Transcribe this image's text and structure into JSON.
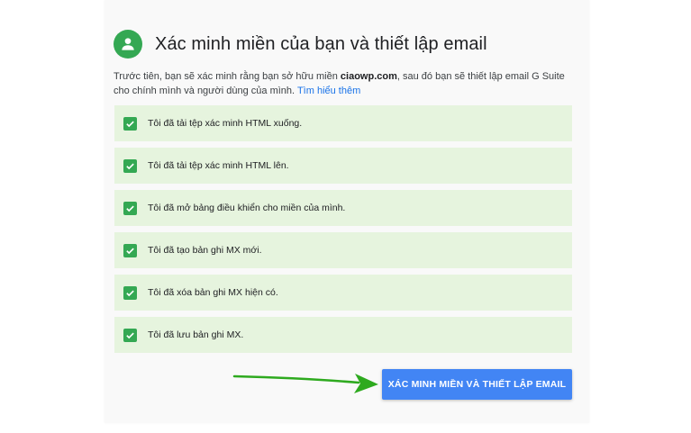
{
  "header": {
    "title": "Xác minh miền của bạn và thiết lập email",
    "icon": "user-avatar-icon",
    "accent_color": "#34a853"
  },
  "intro": {
    "text_before": "Trước tiên, bạn sẽ xác minh rằng bạn sở hữu miền ",
    "domain": "ciaowp.com",
    "text_after": ", sau đó bạn sẽ thiết lập email G Suite cho chính mình và người dùng của mình. ",
    "learn_more": "Tìm hiểu thêm"
  },
  "steps": [
    {
      "label": "Tôi đã tải tệp xác minh HTML xuống.",
      "checked": true
    },
    {
      "label": "Tôi đã tải tệp xác minh HTML lên.",
      "checked": true
    },
    {
      "label": "Tôi đã mở bảng điều khiển cho miền của mình.",
      "checked": true
    },
    {
      "label": "Tôi đã tạo bản ghi MX mới.",
      "checked": true
    },
    {
      "label": "Tôi đã xóa bản ghi MX hiện có.",
      "checked": true
    },
    {
      "label": "Tôi đã lưu bản ghi MX.",
      "checked": true
    }
  ],
  "colors": {
    "step_background": "#e6f4de",
    "checkbox": "#34a853",
    "button": "#4285f4",
    "link": "#1a73e8",
    "arrow": "#2eaa1f"
  },
  "actions": {
    "verify_label": "XÁC MINH MIỀN VÀ THIẾT LẬP EMAIL"
  }
}
